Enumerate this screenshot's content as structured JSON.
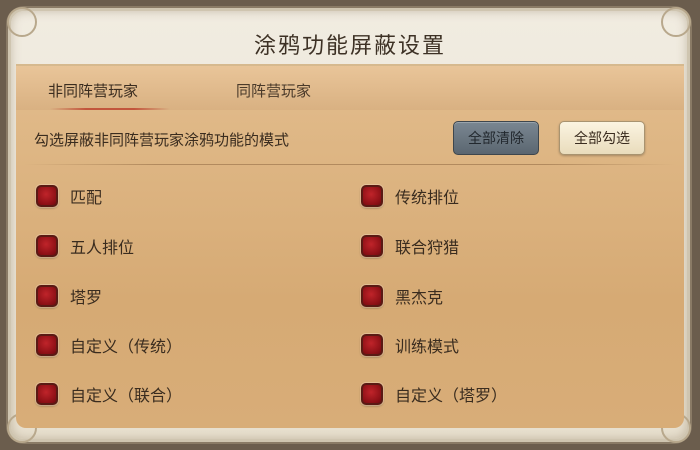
{
  "dialog": {
    "title": "涂鸦功能屏蔽设置"
  },
  "tabs": [
    {
      "label": "非同阵营玩家",
      "active": true
    },
    {
      "label": "同阵营玩家",
      "active": false
    }
  ],
  "instruction": "勾选屏蔽非同阵营玩家涂鸦功能的模式",
  "buttons": {
    "clear_all": "全部清除",
    "check_all": "全部勾选"
  },
  "modes": [
    {
      "label": "匹配",
      "checked": true
    },
    {
      "label": "传统排位",
      "checked": true
    },
    {
      "label": "五人排位",
      "checked": true
    },
    {
      "label": "联合狩猎",
      "checked": true
    },
    {
      "label": "塔罗",
      "checked": true
    },
    {
      "label": "黑杰克",
      "checked": true
    },
    {
      "label": "自定义（传统）",
      "checked": true
    },
    {
      "label": "训练模式",
      "checked": true
    },
    {
      "label": "自定义（联合）",
      "checked": true
    },
    {
      "label": "自定义（塔罗）",
      "checked": true
    }
  ],
  "colors": {
    "checkbox_checked": "#a8171d",
    "panel_bg": "#d9ae7a",
    "tab_highlight": "#c2553c"
  }
}
